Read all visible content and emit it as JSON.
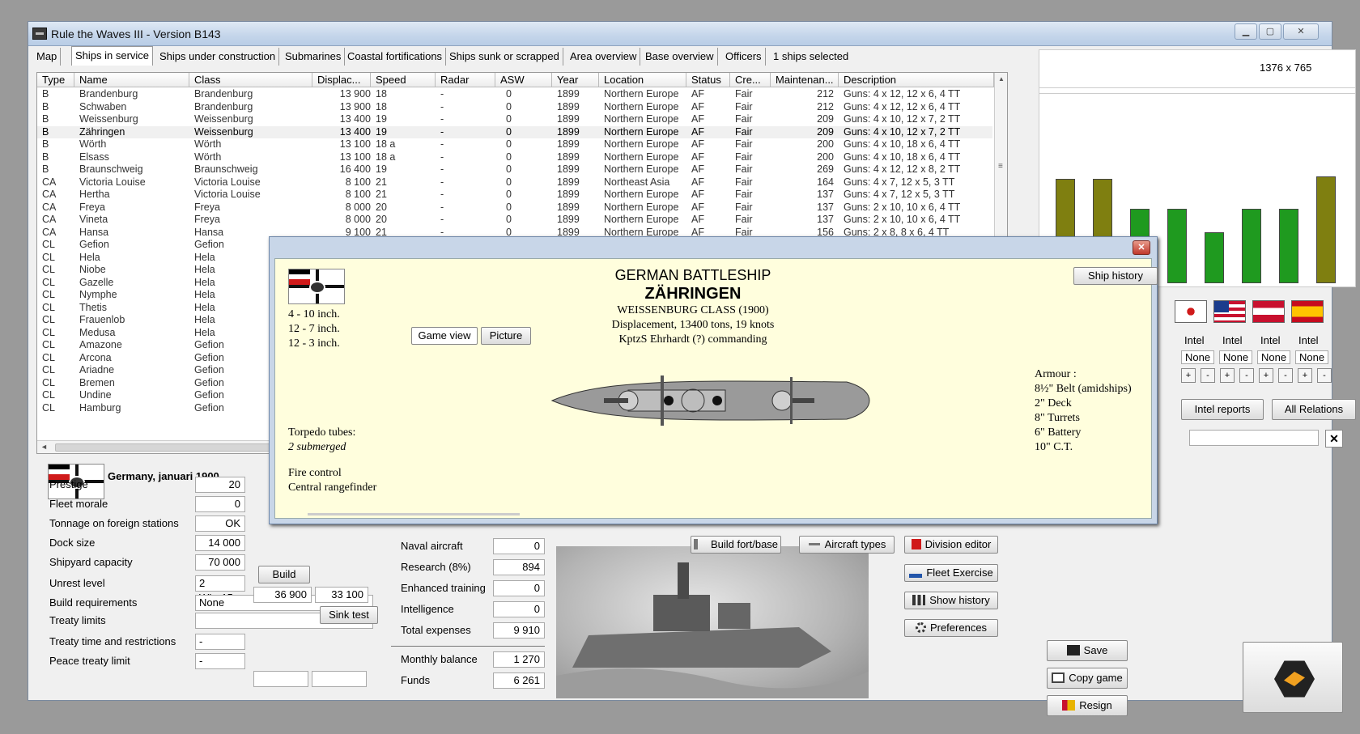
{
  "window": {
    "title": "Rule the Waves III - Version B143"
  },
  "tabs": [
    "Map",
    "Ships in service",
    "Ships under construction",
    "Submarines",
    "Coastal fortifications",
    "Ships sunk or scrapped",
    "Area overview",
    "Base overview",
    "Officers",
    "1 ships selected"
  ],
  "resolution_text": "1376 x 765",
  "table": {
    "columns": [
      "Type",
      "Name",
      "Class",
      "Displac...",
      "Speed",
      "Radar",
      "ASW",
      "Year",
      "Location",
      "Status",
      "Cre...",
      "Maintenan...",
      "Description"
    ],
    "rows": [
      [
        "B",
        "Brandenburg",
        "Brandenburg",
        "13 900",
        "18",
        "-",
        "0",
        "1899",
        "Northern Europe",
        "AF",
        "Fair",
        "212",
        "Guns: 4 x 12, 12 x 6, 4 TT"
      ],
      [
        "B",
        "Schwaben",
        "Brandenburg",
        "13 900",
        "18",
        "-",
        "0",
        "1899",
        "Northern Europe",
        "AF",
        "Fair",
        "212",
        "Guns: 4 x 12, 12 x 6, 4 TT"
      ],
      [
        "B",
        "Weissenburg",
        "Weissenburg",
        "13 400",
        "19",
        "-",
        "0",
        "1899",
        "Northern Europe",
        "AF",
        "Fair",
        "209",
        "Guns: 4 x 10, 12 x 7, 2 TT"
      ],
      [
        "B",
        "Zähringen",
        "Weissenburg",
        "13 400",
        "19",
        "-",
        "0",
        "1899",
        "Northern Europe",
        "AF",
        "Fair",
        "209",
        "Guns: 4 x 10, 12 x 7, 2 TT"
      ],
      [
        "B",
        "Wörth",
        "Wörth",
        "13 100",
        "18 a",
        "-",
        "0",
        "1899",
        "Northern Europe",
        "AF",
        "Fair",
        "200",
        "Guns: 4 x 10, 18 x 6, 4 TT"
      ],
      [
        "B",
        "Elsass",
        "Wörth",
        "13 100",
        "18 a",
        "-",
        "0",
        "1899",
        "Northern Europe",
        "AF",
        "Fair",
        "200",
        "Guns: 4 x 10, 18 x 6, 4 TT"
      ],
      [
        "B",
        "Braunschweig",
        "Braunschweig",
        "16 400",
        "19",
        "-",
        "0",
        "1899",
        "Northern Europe",
        "AF",
        "Fair",
        "269",
        "Guns: 4 x 12, 12 x 8, 2 TT"
      ],
      [
        "CA",
        "Victoria Louise",
        "Victoria Louise",
        "8 100",
        "21",
        "-",
        "0",
        "1899",
        "Northeast Asia",
        "AF",
        "Fair",
        "164",
        "Guns: 4 x 7, 12 x 5, 3 TT"
      ],
      [
        "CA",
        "Hertha",
        "Victoria Louise",
        "8 100",
        "21",
        "-",
        "0",
        "1899",
        "Northern Europe",
        "AF",
        "Fair",
        "137",
        "Guns: 4 x 7, 12 x 5, 3 TT"
      ],
      [
        "CA",
        "Freya",
        "Freya",
        "8 000",
        "20",
        "-",
        "0",
        "1899",
        "Northern Europe",
        "AF",
        "Fair",
        "137",
        "Guns: 2 x 10, 10 x 6, 4 TT"
      ],
      [
        "CA",
        "Vineta",
        "Freya",
        "8 000",
        "20",
        "-",
        "0",
        "1899",
        "Northern Europe",
        "AF",
        "Fair",
        "137",
        "Guns: 2 x 10, 10 x 6, 4 TT"
      ],
      [
        "CA",
        "Hansa",
        "Hansa",
        "9 100",
        "21",
        "-",
        "0",
        "1899",
        "Northern Europe",
        "AF",
        "Fair",
        "156",
        "Guns: 2 x 8, 8 x 6, 4 TT"
      ],
      [
        "CL",
        "Gefion",
        "Gefion",
        "",
        "",
        "",
        "",
        "",
        "",
        "",
        "",
        "",
        ""
      ],
      [
        "CL",
        "Hela",
        "Hela",
        "",
        "",
        "",
        "",
        "",
        "",
        "",
        "",
        "",
        ""
      ],
      [
        "CL",
        "Niobe",
        "Hela",
        "",
        "",
        "",
        "",
        "",
        "",
        "",
        "",
        "",
        ""
      ],
      [
        "CL",
        "Gazelle",
        "Hela",
        "",
        "",
        "",
        "",
        "",
        "",
        "",
        "",
        "",
        ""
      ],
      [
        "CL",
        "Nymphe",
        "Hela",
        "",
        "",
        "",
        "",
        "",
        "",
        "",
        "",
        "",
        ""
      ],
      [
        "CL",
        "Thetis",
        "Hela",
        "",
        "",
        "",
        "",
        "",
        "",
        "",
        "",
        "",
        ""
      ],
      [
        "CL",
        "Frauenlob",
        "Hela",
        "",
        "",
        "",
        "",
        "",
        "",
        "",
        "",
        "",
        ""
      ],
      [
        "CL",
        "Medusa",
        "Hela",
        "",
        "",
        "",
        "",
        "",
        "",
        "",
        "",
        "",
        ""
      ],
      [
        "CL",
        "Amazone",
        "Gefion",
        "",
        "",
        "",
        "",
        "",
        "",
        "",
        "",
        "",
        ""
      ],
      [
        "CL",
        "Arcona",
        "Gefion",
        "",
        "",
        "",
        "",
        "",
        "",
        "",
        "",
        "",
        ""
      ],
      [
        "CL",
        "Ariadne",
        "Gefion",
        "",
        "",
        "",
        "",
        "",
        "",
        "",
        "",
        "",
        ""
      ],
      [
        "CL",
        "Bremen",
        "Gefion",
        "",
        "",
        "",
        "",
        "",
        "",
        "",
        "",
        "",
        ""
      ],
      [
        "CL",
        "Undine",
        "Gefion",
        "",
        "",
        "",
        "",
        "",
        "",
        "",
        "",
        "",
        ""
      ],
      [
        "CL",
        "Hamburg",
        "Gefion",
        "",
        "",
        "",
        "",
        "",
        "",
        "",
        "",
        "",
        ""
      ]
    ]
  },
  "nation": {
    "title": "Germany, januari 1900",
    "fields": [
      {
        "label": "Prestige",
        "value": "20"
      },
      {
        "label": "Fleet morale",
        "value": "0"
      },
      {
        "label": "Tonnage on foreign stations",
        "value": "OK"
      },
      {
        "label": "Dock size",
        "value": "14 000"
      },
      {
        "label": "Shipyard capacity",
        "value": "70 000"
      },
      {
        "label": "Unrest level",
        "value": "2 WL:-15"
      },
      {
        "label": "Build requirements",
        "value": "None"
      },
      {
        "label": "Treaty limits",
        "value": ""
      },
      {
        "label": "Treaty time and restrictions",
        "value": "-"
      },
      {
        "label": "Peace treaty limit",
        "value": "-"
      }
    ],
    "shipyard_extra": [
      "36 900",
      "33 100"
    ],
    "build_label": "Build",
    "sink_test_label": "Sink test"
  },
  "budget": {
    "fields": [
      {
        "label": "Naval aircraft",
        "value": "0"
      },
      {
        "label": "Research (8%)",
        "value": "894"
      },
      {
        "label": "Enhanced training",
        "value": "0"
      },
      {
        "label": "Intelligence",
        "value": "0"
      },
      {
        "label": "Total expenses",
        "value": "9 910"
      },
      {
        "label": "Monthly balance",
        "value": "1 270"
      },
      {
        "label": "Funds",
        "value": "6 261"
      }
    ]
  },
  "actions": {
    "build_fort": "Build fort/base",
    "aircraft_types": "Aircraft types",
    "division_editor": "Division editor",
    "fleet_exercise": "Fleet Exercise",
    "show_history": "Show history",
    "preferences": "Preferences",
    "save": "Save",
    "copy_game": "Copy game",
    "resign": "Resign",
    "intel_reports": "Intel reports",
    "all_relations": "All Relations"
  },
  "relations": {
    "bar_values": [
      0.74,
      0.74,
      0.53,
      0.53,
      0.36,
      0.53,
      0.53,
      0.76
    ],
    "bar_colors": [
      "#7f7f10",
      "#7f7f10",
      "#1f9a1f",
      "#1f9a1f",
      "#1f9a1f",
      "#1f9a1f",
      "#1f9a1f",
      "#7f7f10"
    ],
    "intel_labels": [
      "Intel",
      "Intel",
      "Intel",
      "Intel"
    ],
    "intel_values": [
      "None",
      "None",
      "None",
      "None"
    ]
  },
  "ship_dialog": {
    "heading": "GERMAN BATTLESHIP",
    "name": "ZÄHRINGEN",
    "class_line": "WEISSENBURG CLASS (1900)",
    "displacement_line": "Displacement, 13400 tons, 19 knots",
    "commander_line": "KptzS Ehrhardt (?)  commanding",
    "ship_history_label": "Ship history",
    "game_view_label": "Game view",
    "picture_label": "Picture",
    "guns": [
      "4 - 10 inch.",
      "12 - 7 inch.",
      "12 - 3 inch."
    ],
    "torpedo_title": "Torpedo tubes:",
    "torpedo_value": "2  submerged",
    "fire_control_title": "Fire control",
    "fire_control_value": "Central rangefinder",
    "armour_title": "Armour :",
    "armour": [
      "8½\" Belt (amidships)",
      "2\" Deck",
      "8\" Turrets",
      "6\" Battery",
      "10\" C.T."
    ]
  }
}
